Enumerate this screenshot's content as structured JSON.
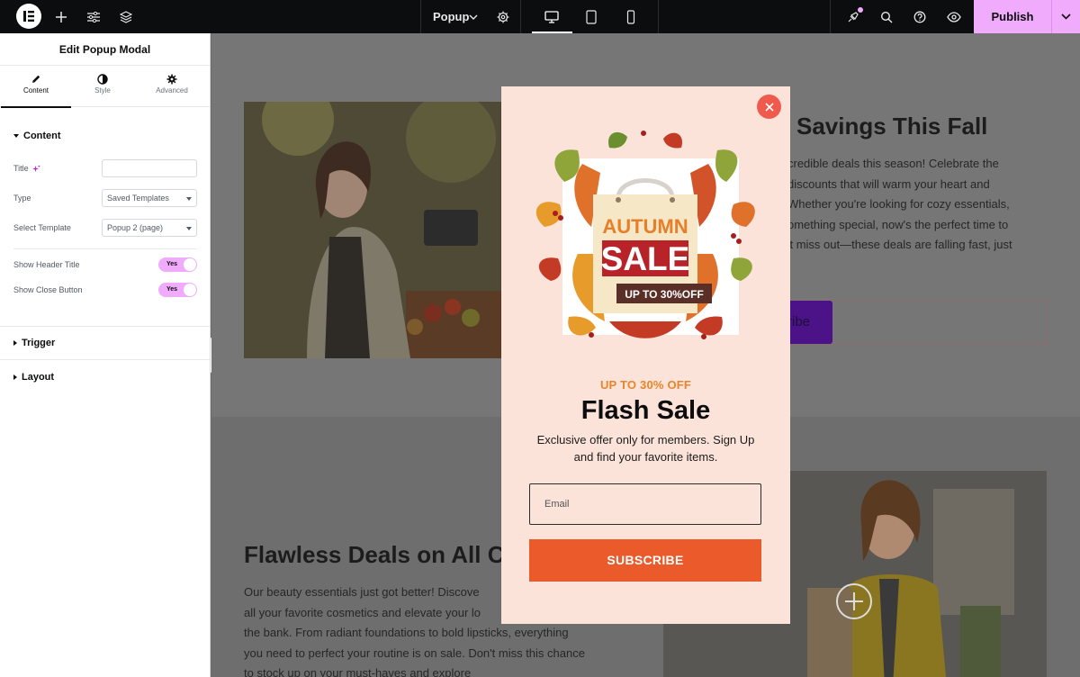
{
  "topbar": {
    "document_name": "Popup",
    "publish_label": "Publish",
    "icons": [
      "elementor-logo-icon",
      "add-icon",
      "settings-sliders-icon",
      "layers-icon",
      "chevron-down-icon",
      "gear-icon",
      "desktop-icon",
      "tablet-icon",
      "mobile-icon",
      "notifications-icon",
      "search-icon",
      "help-icon",
      "preview-eye-icon",
      "chevron-down-icon"
    ],
    "accent_color": "#f0abfc"
  },
  "panel": {
    "title": "Edit Popup Modal",
    "tabs": [
      {
        "label": "Content",
        "icon": "pencil-icon",
        "active": true
      },
      {
        "label": "Style",
        "icon": "half-circle-icon",
        "active": false
      },
      {
        "label": "Advanced",
        "icon": "gear-icon",
        "active": false
      }
    ],
    "content_section": "Content",
    "fields": {
      "title_label": "Title",
      "title_value": "",
      "type_label": "Type",
      "type_value": "Saved Templates",
      "template_label": "Select Template",
      "template_value": "Popup 2 (page)",
      "show_header_label": "Show Header Title",
      "show_header_value": "Yes",
      "show_close_label": "Show Close Button",
      "show_close_value": "Yes"
    },
    "sections": {
      "trigger": "Trigger",
      "layout": "Layout"
    }
  },
  "canvas": {
    "heading1": "Savings This Fall",
    "para1": [
      "credible deals this season! Celebrate the",
      " discounts that will warm your heart and",
      "Whether you're looking for cozy essentials,",
      "omething special, now's the perfect time to",
      "'t miss out—these deals are falling fast, just"
    ],
    "subscribe_fragment": "ribe",
    "heading2": "Flawless Deals on All Co",
    "para2": [
      "Our beauty essentials just got better! Discove",
      "all your favorite cosmetics and elevate your lo",
      "the bank. From radiant foundations to bold lipsticks, everything",
      "you need to perfect your routine is on sale. Don't miss this chance",
      "to stock up on your must-haves and explore"
    ]
  },
  "popup": {
    "art": {
      "line1": "AUTUMN",
      "line2": "SALE",
      "line3": "UP TO 30%OFF"
    },
    "eyebrow": "UP TO 30% OFF",
    "title": "Flash Sale",
    "description": "Exclusive offer only for members. Sign Up and find your favorite items.",
    "email_placeholder": "Email",
    "button_label": "SUBSCRIBE",
    "colors": {
      "background": "#fbe3d9",
      "button": "#ea5a2b",
      "close": "#ef5a4d",
      "eyebrow": "#e8852a"
    }
  }
}
